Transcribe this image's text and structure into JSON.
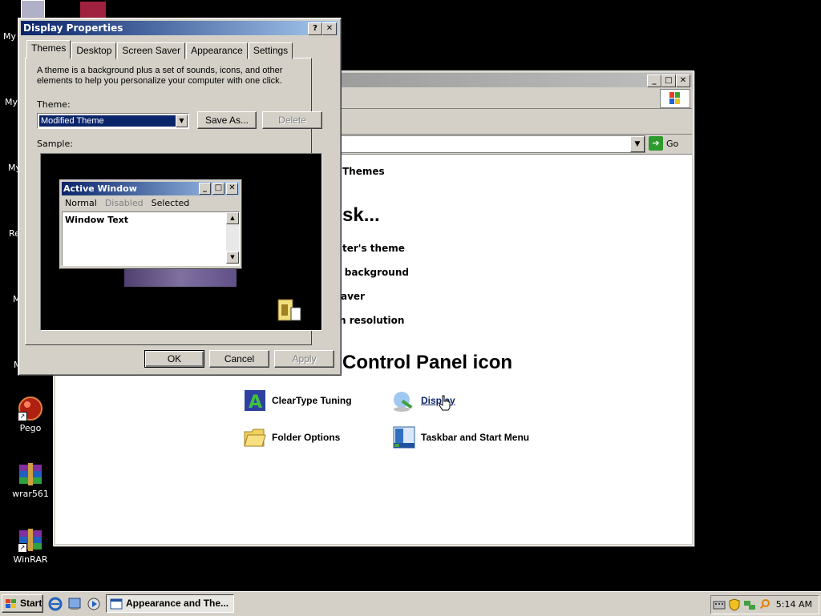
{
  "desktop": {
    "icons": [
      {
        "label": "Pego"
      },
      {
        "label": "wrar561"
      },
      {
        "label": "WinRAR"
      }
    ],
    "partial_labels": [
      "My",
      "My",
      "My",
      "Re",
      "M",
      "M"
    ]
  },
  "explorer": {
    "go_label": "Go",
    "content": {
      "themes_link": "Themes",
      "task_heading": "sk...",
      "tasks": [
        "ter's theme",
        "p background",
        "aver",
        "n resolution"
      ],
      "icon_heading": "Control Panel icon",
      "icons": [
        {
          "label": "ClearType Tuning",
          "icon": "cleartype-icon"
        },
        {
          "label": "Display",
          "icon": "display-icon"
        },
        {
          "label": "Folder Options",
          "icon": "folder-options-icon"
        },
        {
          "label": "Taskbar and Start Menu",
          "icon": "taskbar-icon"
        }
      ]
    }
  },
  "dialog": {
    "title": "Display Properties",
    "tabs": [
      "Themes",
      "Desktop",
      "Screen Saver",
      "Appearance",
      "Settings"
    ],
    "description": "A theme is a background plus a set of sounds, icons, and other elements to help you personalize your computer with one click.",
    "theme_label": "Theme:",
    "theme_value": "Modified Theme",
    "save_as": "Save As...",
    "delete": "Delete",
    "sample_label": "Sample:",
    "sample": {
      "window_title": "Active Window",
      "menu": [
        "Normal",
        "Disabled",
        "Selected"
      ],
      "window_text": "Window Text"
    },
    "ok": "OK",
    "cancel": "Cancel",
    "apply": "Apply"
  },
  "taskbar": {
    "start": "Start",
    "task": "Appearance and The...",
    "clock": "5:14 AM"
  }
}
